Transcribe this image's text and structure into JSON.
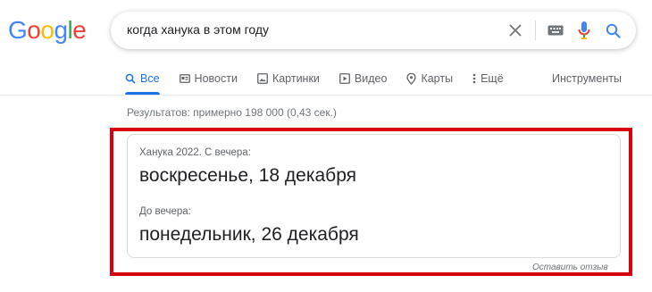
{
  "logo": {
    "letters": [
      "G",
      "o",
      "o",
      "g",
      "l",
      "e"
    ],
    "colors": [
      "#4285F4",
      "#EA4335",
      "#FBBC05",
      "#4285F4",
      "#34A853",
      "#EA4335"
    ]
  },
  "search": {
    "query": "когда ханука в этом году",
    "icons": {
      "clear": "close-icon",
      "keyboard": "keyboard-icon",
      "voice": "microphone-icon",
      "search": "search-icon"
    }
  },
  "tabs": [
    {
      "label": "Все",
      "icon": "search-icon",
      "active": true
    },
    {
      "label": "Новости",
      "icon": "news-icon",
      "active": false
    },
    {
      "label": "Картинки",
      "icon": "image-icon",
      "active": false
    },
    {
      "label": "Видео",
      "icon": "video-icon",
      "active": false
    },
    {
      "label": "Карты",
      "icon": "map-pin-icon",
      "active": false
    },
    {
      "label": "Ещё",
      "icon": "more-vertical-icon",
      "active": false
    }
  ],
  "tools_label": "Инструменты",
  "result_stats": "Результатов: примерно 198 000 (0,43 сек.)",
  "answer": {
    "label_start": "Ханука 2022. С вечера:",
    "value_start": "воскресенье, 18 декабря",
    "label_end": "До вечера:",
    "value_end": "понедельник, 26 декабря"
  },
  "feedback_label": "Оставить отзыв",
  "colors": {
    "accent": "#1a73e8",
    "highlight_frame": "#d9000d"
  }
}
